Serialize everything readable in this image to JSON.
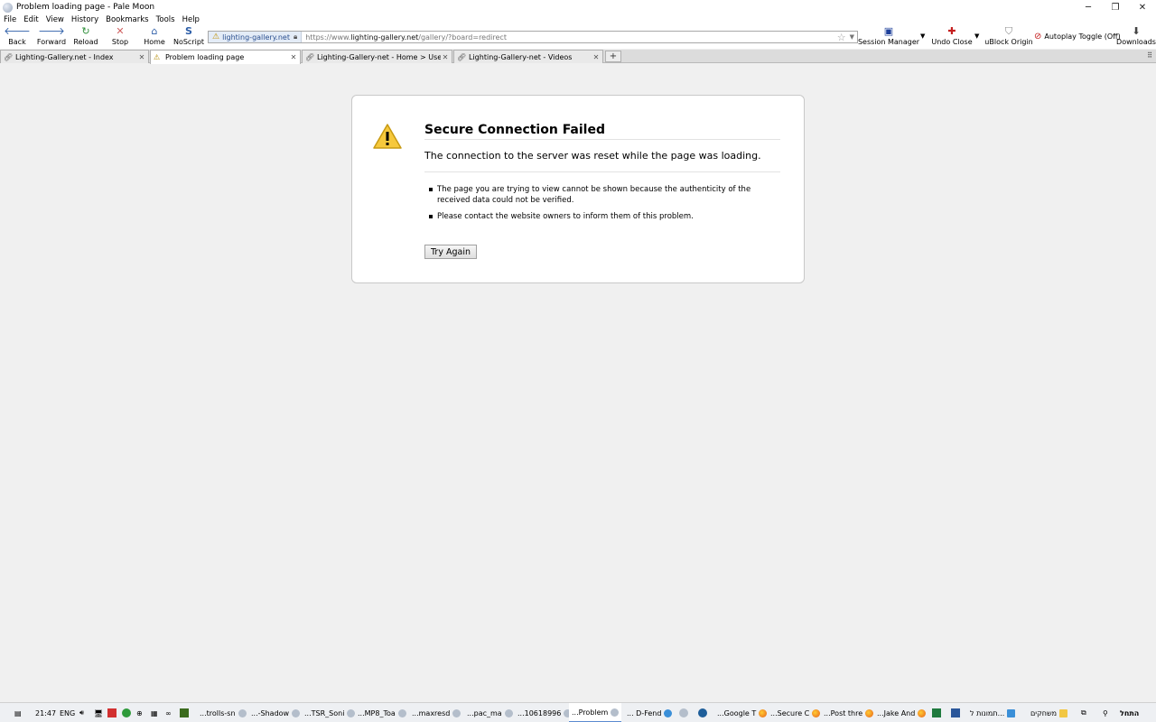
{
  "window": {
    "title": "Problem loading page - Pale Moon",
    "controls": {
      "minimize": "─",
      "maximize": "❐",
      "close": "✕"
    }
  },
  "menu": [
    "File",
    "Edit",
    "View",
    "History",
    "Bookmarks",
    "Tools",
    "Help"
  ],
  "toolbar": {
    "back": "Back",
    "forward": "Forward",
    "reload": "Reload",
    "stop": "Stop",
    "home": "Home",
    "noscript": "NoScript",
    "session_manager": "Session Manager",
    "undo_close": "Undo Close",
    "ublock": "uBlock Origin",
    "autoplay": "Autoplay Toggle (Off)",
    "downloads": "Downloads"
  },
  "urlbar": {
    "identity": "lighting-gallery.net",
    "url_prefix": "https://www.",
    "url_host": "lighting-gallery.net",
    "url_path": "/gallery/?board=redirect"
  },
  "tabs": [
    {
      "label": "Lighting-Gallery.net - Index",
      "icon": "globe-icon",
      "active": false
    },
    {
      "label": "Problem loading page",
      "icon": "warning-icon",
      "active": true
    },
    {
      "label": "Lighting-Gallery-net - Home > User g...",
      "icon": "link-icon",
      "active": false
    },
    {
      "label": "Lighting-Gallery-net - Videos",
      "icon": "link-icon",
      "active": false
    }
  ],
  "error": {
    "title": "Secure Connection Failed",
    "description": "The connection to the server was reset while the page was loading.",
    "bullets": [
      "The page you are trying to view cannot be shown because the authenticity of the received data could not be verified.",
      "Please contact the website owners to inform them of this problem."
    ],
    "try_again": "Try Again"
  },
  "taskbar": {
    "time": "21:47",
    "language": "ENG",
    "tasks": [
      {
        "label": "...trolls-sn",
        "icon": "browser-icon"
      },
      {
        "label": "...-Shadow",
        "icon": "browser-icon"
      },
      {
        "label": "...TSR_Soni",
        "icon": "browser-icon"
      },
      {
        "label": "...MP8_Toa",
        "icon": "browser-icon"
      },
      {
        "label": "...maxresd",
        "icon": "browser-icon"
      },
      {
        "label": "...pac_ma",
        "icon": "browser-icon"
      },
      {
        "label": "...10618996",
        "icon": "browser-icon"
      },
      {
        "label": "...Problem",
        "icon": "browser-icon"
      },
      {
        "label": "... D-Fend",
        "icon": "app-icon"
      },
      {
        "label": "...Google T",
        "icon": "firefox-icon"
      },
      {
        "label": "...Secure C",
        "icon": "firefox-icon"
      },
      {
        "label": "...Post thre",
        "icon": "firefox-icon"
      },
      {
        "label": "...Jake And",
        "icon": "firefox-icon"
      },
      {
        "label": "תמונות ל...",
        "icon": "folder-icon"
      },
      {
        "label": "משחקים",
        "icon": "folder-icon"
      }
    ],
    "start": "התחל"
  }
}
